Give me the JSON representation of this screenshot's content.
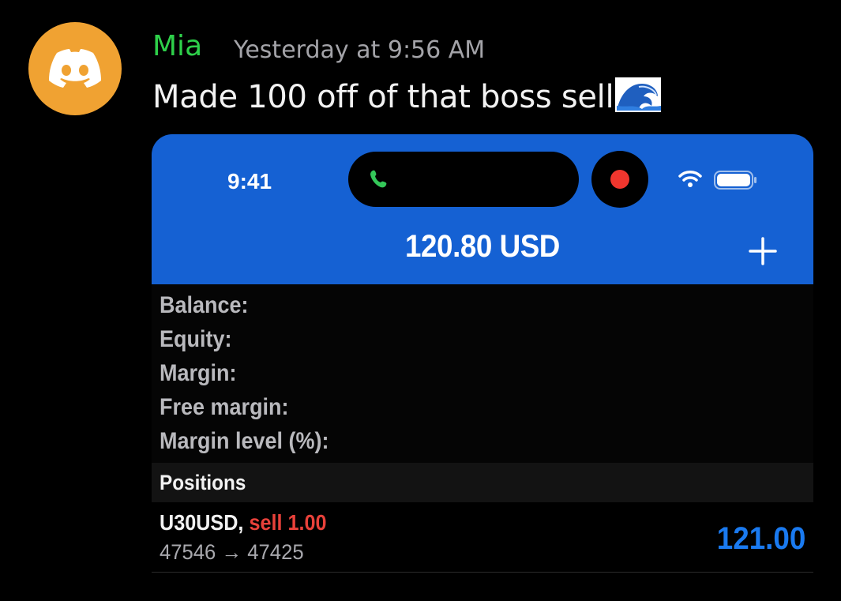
{
  "message": {
    "author": "Mia",
    "timestamp": "Yesterday at 9:56 AM",
    "text": "Made 100 off of that boss sell",
    "emoji": "wave-icon",
    "author_color": "#2ed04a",
    "avatar_color": "#f0a232",
    "avatar_icon": "discord-logo-icon"
  },
  "attachment": {
    "status_bar": {
      "time": "9:41",
      "icons": [
        "phone-icon",
        "record-dot-icon",
        "wifi-icon",
        "battery-icon"
      ]
    },
    "header": {
      "balance_title": "120.80 USD",
      "add_icon": "plus-icon",
      "background_color": "#1561d3"
    },
    "summary": {
      "rows": [
        "Balance:",
        "Equity:",
        "Margin:",
        "Free margin:",
        "Margin level (%):"
      ]
    },
    "positions": {
      "label": "Positions",
      "items": [
        {
          "symbol": "U30USD,",
          "side": "sell 1.00",
          "open_price": "47546",
          "arrow": "→",
          "current_price": "47425",
          "profit": "121.00"
        }
      ]
    }
  }
}
